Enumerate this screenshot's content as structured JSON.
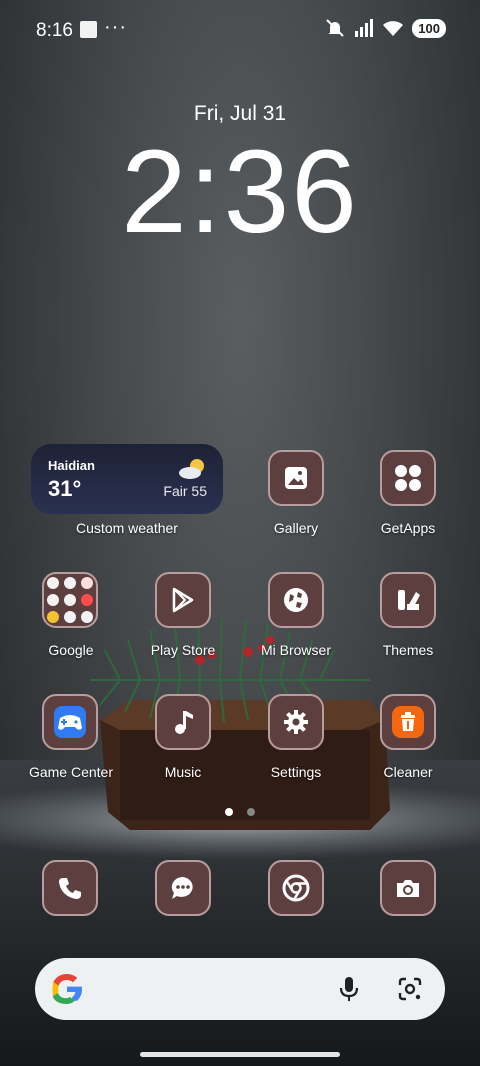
{
  "status_bar": {
    "time": "8:16",
    "dots": "···",
    "battery": "100",
    "icons": [
      "notification-square-icon",
      "mute-icon",
      "signal-icon",
      "wifi-icon",
      "battery-icon"
    ]
  },
  "lockscreen": {
    "date": "Fri, Jul 31",
    "clock": "2:36"
  },
  "weather_widget": {
    "city": "Haidian",
    "temp": "31°",
    "condition": "Fair 55",
    "label": "Custom weather",
    "icon": "partly-cloudy-icon"
  },
  "apps": {
    "gallery": "Gallery",
    "getapps": "GetApps",
    "google": "Google",
    "playstore": "Play Store",
    "mibrowser": "Mi Browser",
    "themes": "Themes",
    "gamecenter": "Game Center",
    "music": "Music",
    "settings": "Settings",
    "cleaner": "Cleaner"
  },
  "dock": [
    "phone-icon",
    "messages-icon",
    "chrome-icon",
    "camera-icon"
  ],
  "search_bar": {
    "icons": [
      "google-g-icon",
      "mic-icon",
      "lens-icon"
    ]
  },
  "colors": {
    "icon_bg": "#5e3f3f",
    "icon_border": "#b79d9d",
    "weather_bg": "#1e2236",
    "cleaner_orange": "#f4670f",
    "gamecenter_blue": "#2f7bf1"
  }
}
